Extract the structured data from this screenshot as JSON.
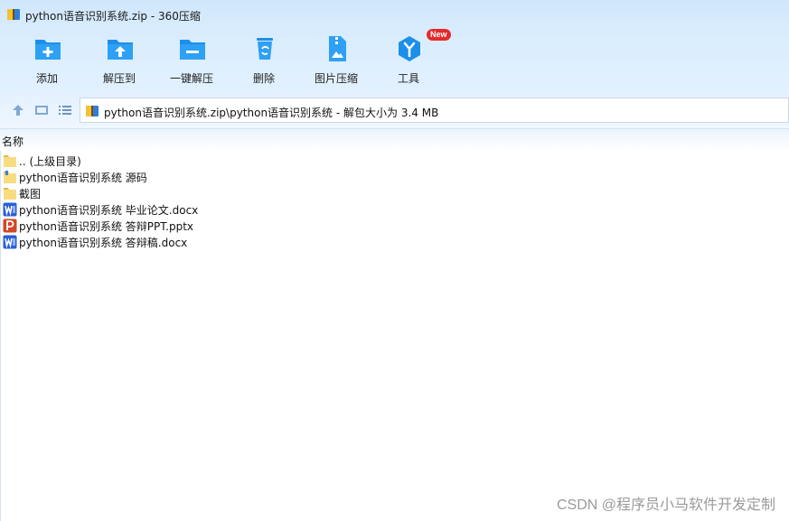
{
  "window": {
    "title": "python语音识别系统.zip - 360压缩"
  },
  "toolbar": {
    "items": [
      {
        "label": "添加",
        "icon": "add-folder-icon"
      },
      {
        "label": "解压到",
        "icon": "extract-to-icon"
      },
      {
        "label": "一键解压",
        "icon": "one-click-extract-icon"
      },
      {
        "label": "删除",
        "icon": "recycle-bin-icon"
      },
      {
        "label": "图片压缩",
        "icon": "image-compress-icon"
      },
      {
        "label": "工具",
        "icon": "tools-icon",
        "badge": "New"
      }
    ]
  },
  "address": {
    "path": "python语音识别系统.zip\\python语音识别系统 - 解包大小为 3.4 MB"
  },
  "list": {
    "column_header": "名称",
    "rows": [
      {
        "name": ".. (上级目录)",
        "icon": "folder-icon"
      },
      {
        "name": "python语音识别系统 源码",
        "icon": "folder-code-icon"
      },
      {
        "name": "截图",
        "icon": "folder-icon"
      },
      {
        "name": "python语音识别系统 毕业论文.docx",
        "icon": "word-doc-icon"
      },
      {
        "name": "python语音识别系统 答辩PPT.pptx",
        "icon": "ppt-icon"
      },
      {
        "name": "python语音识别系统 答辩稿.docx",
        "icon": "word-doc-icon"
      }
    ]
  },
  "watermark": "CSDN @程序员小马软件开发定制",
  "colors": {
    "accent": "#1e8fe8",
    "title_bg": "#cfe6fb",
    "word": "#2b5fd9",
    "ppt": "#d24726",
    "folder": "#f6d36b"
  }
}
